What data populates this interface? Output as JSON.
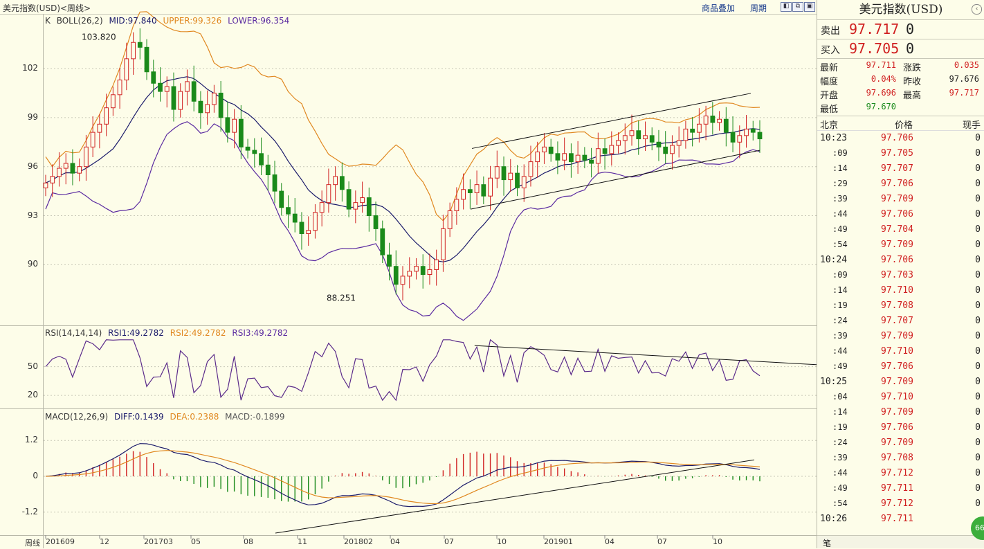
{
  "header": {
    "title": "美元指数(USD)<周线>",
    "overlay_label": "商品叠加",
    "period_label": "周期",
    "tools": [
      "◧",
      "⧉",
      "▣"
    ]
  },
  "kline": {
    "legend_k": "K",
    "legend_name": "BOLL(26,2)",
    "mid": "MID:97.840",
    "upper": "UPPER:99.326",
    "lower": "LOWER:96.354",
    "high_label": "103.820",
    "low_label": "88.251",
    "ylabels": [
      "102",
      "99",
      "96",
      "93",
      "90"
    ],
    "ylabel_values": [
      102,
      99,
      96,
      93,
      90
    ],
    "ylim": [
      86.5,
      104.5
    ]
  },
  "rsi": {
    "legend_name": "RSI(14,14,14)",
    "rsi1": "RSI1:49.2782",
    "rsi2": "RSI2:49.2782",
    "rsi3": "RSI3:49.2782",
    "ylabels": [
      "50",
      "20"
    ],
    "ylabel_values": [
      50,
      20
    ],
    "ylim": [
      10,
      80
    ]
  },
  "macd": {
    "legend_name": "MACD(12,26,9)",
    "diff": "DIFF:0.1439",
    "dea": "DEA:0.2388",
    "macd": "MACD:-0.1899",
    "ylabels": [
      "1.2",
      "0",
      "-1.2"
    ],
    "ylabel_values": [
      1.2,
      0,
      -1.2
    ],
    "ylim": [
      -1.9,
      1.9
    ]
  },
  "xaxis": {
    "period_label": "周线",
    "labels": [
      "201609",
      "12",
      "201703",
      "05",
      "08",
      "11",
      "201802",
      "04",
      "07",
      "10",
      "201901",
      "04",
      "07",
      "10"
    ]
  },
  "colors": {
    "up": "#d02020",
    "down": "#1a8a1a",
    "mid": "#1a1a6a",
    "upper": "#e08820",
    "lower": "#5a2aa0",
    "rsi": "#5a2a8a",
    "diff": "#1a1a6a",
    "dea": "#e08820"
  },
  "side": {
    "title": "美元指数(USD)",
    "sell_label": "卖出",
    "sell_price": "97.717",
    "sell_vol": "0",
    "buy_label": "买入",
    "buy_price": "97.705",
    "buy_vol": "0",
    "stats": [
      {
        "k": "最新",
        "v": "97.711",
        "color": "red"
      },
      {
        "k": "涨跌",
        "v": "0.035",
        "color": "red"
      },
      {
        "k": "幅度",
        "v": "0.04%",
        "color": "red"
      },
      {
        "k": "昨收",
        "v": "97.676",
        "color": "plain"
      },
      {
        "k": "开盘",
        "v": "97.696",
        "color": "red"
      },
      {
        "k": "最高",
        "v": "97.717",
        "color": "red"
      },
      {
        "k": "最低",
        "v": "97.670",
        "color": "green"
      }
    ],
    "ticks_header": {
      "time": "北京",
      "price": "价格",
      "hand": "现手"
    },
    "ticks": [
      {
        "t": "10:23",
        "p": "97.706",
        "h": "0",
        "full": true
      },
      {
        "t": ":09",
        "p": "97.705",
        "h": "0",
        "full": false
      },
      {
        "t": ":14",
        "p": "97.707",
        "h": "0",
        "full": false
      },
      {
        "t": ":29",
        "p": "97.706",
        "h": "0",
        "full": false
      },
      {
        "t": ":39",
        "p": "97.709",
        "h": "0",
        "full": false
      },
      {
        "t": ":44",
        "p": "97.706",
        "h": "0",
        "full": false
      },
      {
        "t": ":49",
        "p": "97.704",
        "h": "0",
        "full": false
      },
      {
        "t": ":54",
        "p": "97.709",
        "h": "0",
        "full": false
      },
      {
        "t": "10:24",
        "p": "97.706",
        "h": "0",
        "full": true
      },
      {
        "t": ":09",
        "p": "97.703",
        "h": "0",
        "full": false
      },
      {
        "t": ":14",
        "p": "97.710",
        "h": "0",
        "full": false
      },
      {
        "t": ":19",
        "p": "97.708",
        "h": "0",
        "full": false
      },
      {
        "t": ":24",
        "p": "97.707",
        "h": "0",
        "full": false
      },
      {
        "t": ":39",
        "p": "97.709",
        "h": "0",
        "full": false
      },
      {
        "t": ":44",
        "p": "97.710",
        "h": "0",
        "full": false
      },
      {
        "t": ":49",
        "p": "97.706",
        "h": "0",
        "full": false
      },
      {
        "t": "10:25",
        "p": "97.709",
        "h": "0",
        "full": true
      },
      {
        "t": ":04",
        "p": "97.710",
        "h": "0",
        "full": false
      },
      {
        "t": ":14",
        "p": "97.709",
        "h": "0",
        "full": false
      },
      {
        "t": ":19",
        "p": "97.706",
        "h": "0",
        "full": false
      },
      {
        "t": ":24",
        "p": "97.709",
        "h": "0",
        "full": false
      },
      {
        "t": ":39",
        "p": "97.708",
        "h": "0",
        "full": false
      },
      {
        "t": ":44",
        "p": "97.712",
        "h": "0",
        "full": false
      },
      {
        "t": ":49",
        "p": "97.711",
        "h": "0",
        "full": false
      },
      {
        "t": ":54",
        "p": "97.712",
        "h": "0",
        "full": false
      },
      {
        "t": "10:26",
        "p": "97.711",
        "h": "",
        "full": true
      }
    ],
    "bottom_tab": "笔",
    "badge": "66"
  },
  "chart_data": [
    {
      "type": "candlestick",
      "title": "美元指数(USD)<周线>",
      "indicator": "BOLL(26,2)",
      "key_values": {
        "MID": 97.84,
        "UPPER": 99.326,
        "LOWER": 96.354,
        "annotated_high": 103.82,
        "annotated_low": 88.251
      },
      "close_path": [
        95.0,
        95.4,
        95.9,
        96.2,
        95.6,
        96.0,
        97.2,
        98.1,
        98.6,
        99.6,
        100.4,
        101.3,
        102.6,
        103.6,
        103.3,
        101.8,
        101.1,
        100.6,
        100.9,
        99.5,
        100.6,
        101.2,
        100.0,
        99.3,
        99.8,
        100.5,
        99.0,
        98.1,
        98.9,
        97.2,
        97.0,
        96.8,
        96.1,
        95.5,
        94.5,
        93.5,
        93.1,
        92.6,
        91.9,
        92.1,
        93.2,
        93.8,
        94.9,
        95.4,
        94.6,
        93.4,
        93.8,
        94.1,
        93.0,
        92.2,
        90.6,
        89.9,
        88.8,
        89.3,
        89.6,
        89.9,
        89.4,
        89.7,
        90.3,
        92.2,
        93.3,
        94.0,
        94.6,
        94.4,
        94.9,
        94.2,
        95.3,
        96.0,
        95.2,
        95.6,
        94.7,
        95.4,
        96.3,
        96.9,
        97.2,
        96.8,
        96.4,
        96.8,
        96.3,
        96.7,
        96.4,
        96.2,
        97.1,
        96.8,
        97.3,
        97.6,
        97.9,
        98.2,
        97.7,
        97.9,
        97.5,
        97.2,
        96.8,
        97.3,
        97.6,
        98.3,
        98.1,
        98.6,
        99.1,
        98.7,
        98.9,
        98.1,
        97.5,
        97.9,
        98.3,
        98.1,
        97.7
      ]
    },
    {
      "type": "line",
      "indicator": "RSI(14,14,14)",
      "series": [
        {
          "name": "RSI1",
          "last": 49.2782
        },
        {
          "name": "RSI2",
          "last": 49.2782
        },
        {
          "name": "RSI3",
          "last": 49.2782
        }
      ]
    },
    {
      "type": "bar",
      "indicator": "MACD(12,26,9)",
      "series": [
        {
          "name": "DIFF",
          "last": 0.1439
        },
        {
          "name": "DEA",
          "last": 0.2388
        },
        {
          "name": "MACD",
          "last": -0.1899
        }
      ]
    }
  ]
}
